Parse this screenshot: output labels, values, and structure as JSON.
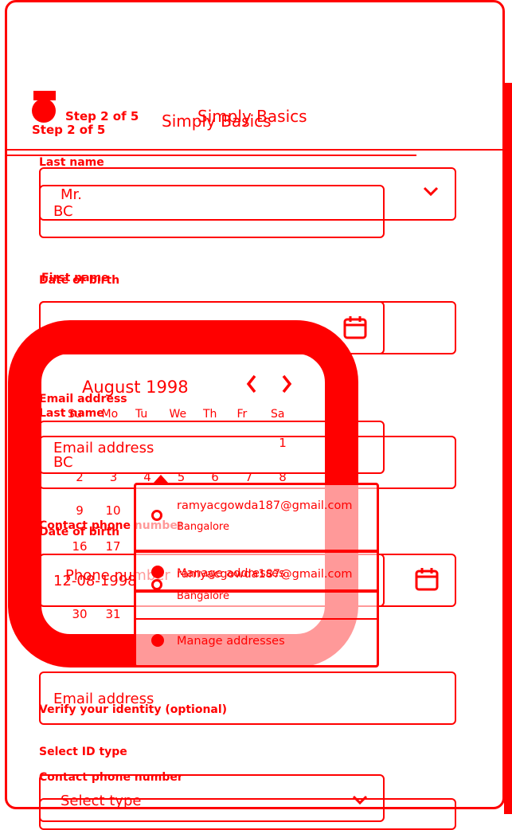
{
  "header": {
    "step_label": "Step 2 of 5",
    "step_label_ghost": "Step 2 of 5",
    "title": "Simply Basics",
    "title_ghost": "Simply Basics"
  },
  "form": {
    "last_name_label": "Last name",
    "salutation_value": "Mr.",
    "last_name_value": "BC",
    "date_of_birth_label": "Date of birth",
    "first_name_label_ghost": "First name",
    "email_label": "Email address",
    "last_name_label_ghost": "Last name",
    "email_placeholder": "Email address",
    "last_name_value_ghost": "BC",
    "contact_phone_label": "Contact phone number",
    "date_of_birth_label_ghost": "Date of birth",
    "phone_placeholder": "Phone number",
    "dob_value": "12-08-1998",
    "email_placeholder_ghost": "Email address",
    "verify_identity_heading": "Verify your identity (optional)",
    "select_id_type_label": "Select ID type",
    "contact_phone_label_ghost": "Contact phone number",
    "select_type_placeholder": "Select type"
  },
  "calendar": {
    "month_year": "August 1998",
    "weekdays": [
      "Su",
      "Mo",
      "Tu",
      "We",
      "Th",
      "Fr",
      "Sa"
    ],
    "days_row1": [
      "1"
    ],
    "days_row2": [
      "2",
      "3",
      "4",
      "5",
      "6",
      "7",
      "8"
    ],
    "days_row3": [
      "9",
      "10"
    ],
    "days_row4": [
      "16",
      "17"
    ],
    "days_row6": [
      "30",
      "31"
    ]
  },
  "autocomplete": {
    "suggestion_email": "ramyacgowda187@gmail.com",
    "suggestion_city": "Bangalore",
    "manage_addresses": "Manage addresses",
    "suggestion_email_ghost": "ramyacgowda187@gmail.com",
    "suggestion_city_ghost": "Bangalore",
    "manage_addresses_ghost": "Manage addresses"
  },
  "colors": {
    "accent": "#ff0000",
    "background": "#ffffff"
  },
  "icons": [
    "calendar-icon",
    "chevron-down-icon",
    "chevron-left-icon",
    "chevron-right-icon",
    "person-pin-icon",
    "manage-icon",
    "avatar-icon"
  ]
}
